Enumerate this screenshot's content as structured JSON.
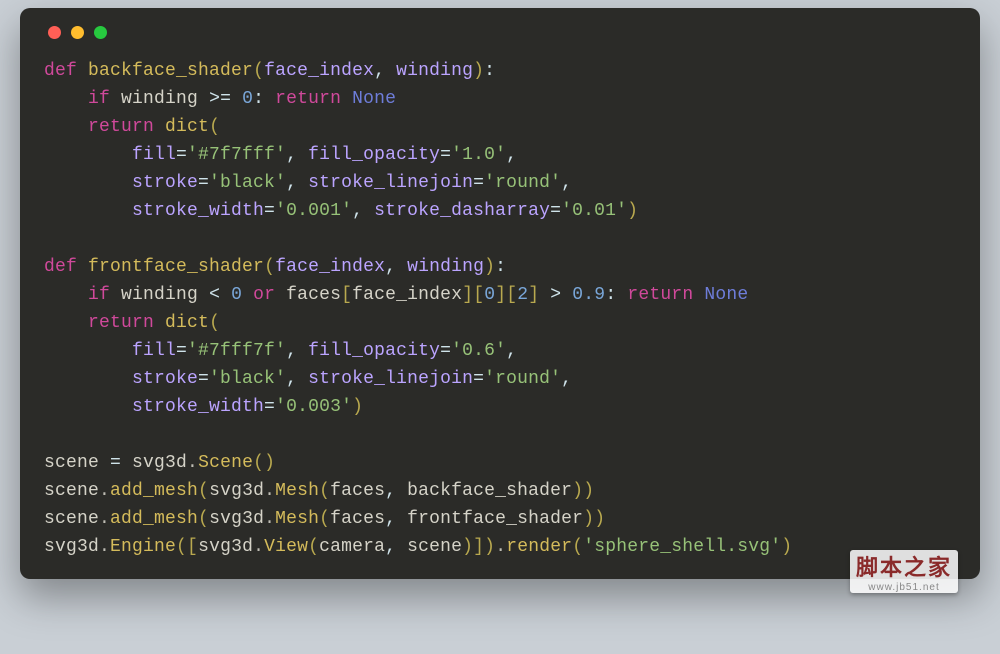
{
  "window": {
    "traffic_lights": [
      "close",
      "minimize",
      "zoom"
    ]
  },
  "code": {
    "lines": [
      [
        [
          "kw",
          "def"
        ],
        [
          "pr",
          " "
        ],
        [
          "fn",
          "backface_shader"
        ],
        [
          "br",
          "("
        ],
        [
          "pn",
          "face_index"
        ],
        [
          "pr",
          ", "
        ],
        [
          "pn",
          "winding"
        ],
        [
          "br",
          ")"
        ],
        [
          "pr",
          ":"
        ]
      ],
      [
        [
          "pr",
          "    "
        ],
        [
          "kw",
          "if"
        ],
        [
          "pr",
          " "
        ],
        [
          "id",
          "winding"
        ],
        [
          "pr",
          " >= "
        ],
        [
          "nm",
          "0"
        ],
        [
          "pr",
          ": "
        ],
        [
          "kw",
          "return"
        ],
        [
          "pr",
          " "
        ],
        [
          "lit",
          "None"
        ]
      ],
      [
        [
          "pr",
          "    "
        ],
        [
          "kw",
          "return"
        ],
        [
          "pr",
          " "
        ],
        [
          "fn",
          "dict"
        ],
        [
          "br",
          "("
        ]
      ],
      [
        [
          "pr",
          "        "
        ],
        [
          "pn",
          "fill"
        ],
        [
          "pr",
          "="
        ],
        [
          "str",
          "'#7f7fff'"
        ],
        [
          "pr",
          ", "
        ],
        [
          "pn",
          "fill_opacity"
        ],
        [
          "pr",
          "="
        ],
        [
          "str",
          "'1.0'"
        ],
        [
          "pr",
          ","
        ]
      ],
      [
        [
          "pr",
          "        "
        ],
        [
          "pn",
          "stroke"
        ],
        [
          "pr",
          "="
        ],
        [
          "str",
          "'black'"
        ],
        [
          "pr",
          ", "
        ],
        [
          "pn",
          "stroke_linejoin"
        ],
        [
          "pr",
          "="
        ],
        [
          "str",
          "'round'"
        ],
        [
          "pr",
          ","
        ]
      ],
      [
        [
          "pr",
          "        "
        ],
        [
          "pn",
          "stroke_width"
        ],
        [
          "pr",
          "="
        ],
        [
          "str",
          "'0.001'"
        ],
        [
          "pr",
          ", "
        ],
        [
          "pn",
          "stroke_dasharray"
        ],
        [
          "pr",
          "="
        ],
        [
          "str",
          "'0.01'"
        ],
        [
          "br",
          ")"
        ]
      ],
      [],
      [
        [
          "kw",
          "def"
        ],
        [
          "pr",
          " "
        ],
        [
          "fn",
          "frontface_shader"
        ],
        [
          "br",
          "("
        ],
        [
          "pn",
          "face_index"
        ],
        [
          "pr",
          ", "
        ],
        [
          "pn",
          "winding"
        ],
        [
          "br",
          ")"
        ],
        [
          "pr",
          ":"
        ]
      ],
      [
        [
          "pr",
          "    "
        ],
        [
          "kw",
          "if"
        ],
        [
          "pr",
          " "
        ],
        [
          "id",
          "winding"
        ],
        [
          "pr",
          " < "
        ],
        [
          "nm",
          "0"
        ],
        [
          "pr",
          " "
        ],
        [
          "kw",
          "or"
        ],
        [
          "pr",
          " "
        ],
        [
          "id",
          "faces"
        ],
        [
          "br",
          "["
        ],
        [
          "id",
          "face_index"
        ],
        [
          "br",
          "]["
        ],
        [
          "nm",
          "0"
        ],
        [
          "br",
          "]["
        ],
        [
          "nm",
          "2"
        ],
        [
          "br",
          "]"
        ],
        [
          "pr",
          " > "
        ],
        [
          "nm",
          "0.9"
        ],
        [
          "pr",
          ": "
        ],
        [
          "kw",
          "return"
        ],
        [
          "pr",
          " "
        ],
        [
          "lit",
          "None"
        ]
      ],
      [
        [
          "pr",
          "    "
        ],
        [
          "kw",
          "return"
        ],
        [
          "pr",
          " "
        ],
        [
          "fn",
          "dict"
        ],
        [
          "br",
          "("
        ]
      ],
      [
        [
          "pr",
          "        "
        ],
        [
          "pn",
          "fill"
        ],
        [
          "pr",
          "="
        ],
        [
          "str",
          "'#7fff7f'"
        ],
        [
          "pr",
          ", "
        ],
        [
          "pn",
          "fill_opacity"
        ],
        [
          "pr",
          "="
        ],
        [
          "str",
          "'0.6'"
        ],
        [
          "pr",
          ","
        ]
      ],
      [
        [
          "pr",
          "        "
        ],
        [
          "pn",
          "stroke"
        ],
        [
          "pr",
          "="
        ],
        [
          "str",
          "'black'"
        ],
        [
          "pr",
          ", "
        ],
        [
          "pn",
          "stroke_linejoin"
        ],
        [
          "pr",
          "="
        ],
        [
          "str",
          "'round'"
        ],
        [
          "pr",
          ","
        ]
      ],
      [
        [
          "pr",
          "        "
        ],
        [
          "pn",
          "stroke_width"
        ],
        [
          "pr",
          "="
        ],
        [
          "str",
          "'0.003'"
        ],
        [
          "br",
          ")"
        ]
      ],
      [],
      [
        [
          "id",
          "scene"
        ],
        [
          "pr",
          " = "
        ],
        [
          "id",
          "svg3d"
        ],
        [
          "dot-op",
          "."
        ],
        [
          "fn",
          "Scene"
        ],
        [
          "br",
          "()"
        ]
      ],
      [
        [
          "id",
          "scene"
        ],
        [
          "dot-op",
          "."
        ],
        [
          "fn",
          "add_mesh"
        ],
        [
          "br",
          "("
        ],
        [
          "id",
          "svg3d"
        ],
        [
          "dot-op",
          "."
        ],
        [
          "fn",
          "Mesh"
        ],
        [
          "br",
          "("
        ],
        [
          "id",
          "faces"
        ],
        [
          "pr",
          ", "
        ],
        [
          "id",
          "backface_shader"
        ],
        [
          "br",
          "))"
        ]
      ],
      [
        [
          "id",
          "scene"
        ],
        [
          "dot-op",
          "."
        ],
        [
          "fn",
          "add_mesh"
        ],
        [
          "br",
          "("
        ],
        [
          "id",
          "svg3d"
        ],
        [
          "dot-op",
          "."
        ],
        [
          "fn",
          "Mesh"
        ],
        [
          "br",
          "("
        ],
        [
          "id",
          "faces"
        ],
        [
          "pr",
          ", "
        ],
        [
          "id",
          "frontface_shader"
        ],
        [
          "br",
          "))"
        ]
      ],
      [
        [
          "id",
          "svg3d"
        ],
        [
          "dot-op",
          "."
        ],
        [
          "fn",
          "Engine"
        ],
        [
          "br",
          "(["
        ],
        [
          "id",
          "svg3d"
        ],
        [
          "dot-op",
          "."
        ],
        [
          "fn",
          "View"
        ],
        [
          "br",
          "("
        ],
        [
          "id",
          "camera"
        ],
        [
          "pr",
          ", "
        ],
        [
          "id",
          "scene"
        ],
        [
          "br",
          ")])"
        ],
        [
          "dot-op",
          "."
        ],
        [
          "fn",
          "render"
        ],
        [
          "br",
          "("
        ],
        [
          "str",
          "'sphere_shell.svg'"
        ],
        [
          "br",
          ")"
        ]
      ]
    ]
  },
  "watermark": {
    "text": "脚本之家",
    "url": "www.jb51.net"
  }
}
